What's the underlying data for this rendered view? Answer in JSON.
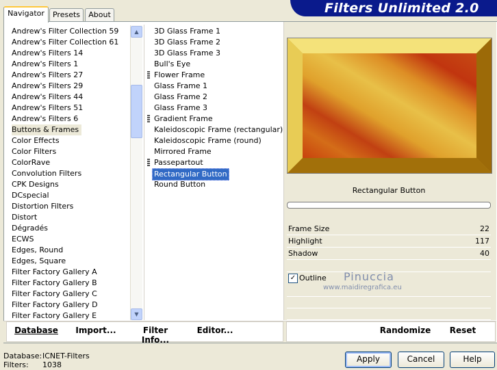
{
  "banner": {
    "title": "Filters Unlimited 2.0"
  },
  "tabs": [
    {
      "label": "Navigator",
      "active": true
    },
    {
      "label": "Presets",
      "active": false
    },
    {
      "label": "About",
      "active": false
    }
  ],
  "categories": {
    "items": [
      "Andrew's Filter Collection 59",
      "Andrew's Filter Collection 61",
      "Andrew's Filters 14",
      "Andrew's Filters 1",
      "Andrew's Filters 27",
      "Andrew's Filters 29",
      "Andrew's Filters 44",
      "Andrew's Filters 51",
      "Andrew's Filters 6",
      "Buttons & Frames",
      "Color Effects",
      "Color Filters",
      "ColorRave",
      "Convolution Filters",
      "CPK Designs",
      "DCspecial",
      "Distortion Filters",
      "Distort",
      "Dégradés",
      "ECWS",
      "Edges, Round",
      "Edges, Square",
      "Filter Factory Gallery A",
      "Filter Factory Gallery B",
      "Filter Factory Gallery C",
      "Filter Factory Gallery D",
      "Filter Factory Gallery E"
    ],
    "selected": "Buttons & Frames"
  },
  "filters": {
    "items": [
      {
        "label": "3D Glass Frame 1",
        "marked": false
      },
      {
        "label": "3D Glass Frame 2",
        "marked": false
      },
      {
        "label": "3D Glass Frame 3",
        "marked": false
      },
      {
        "label": "Bull's Eye",
        "marked": false
      },
      {
        "label": "Flower Frame",
        "marked": true
      },
      {
        "label": "Glass Frame 1",
        "marked": false
      },
      {
        "label": "Glass Frame 2",
        "marked": false
      },
      {
        "label": "Glass Frame 3",
        "marked": false
      },
      {
        "label": "Gradient Frame",
        "marked": true
      },
      {
        "label": "Kaleidoscopic Frame (rectangular)",
        "marked": false
      },
      {
        "label": "Kaleidoscopic Frame (round)",
        "marked": false
      },
      {
        "label": "Mirrored Frame",
        "marked": false
      },
      {
        "label": "Passepartout",
        "marked": true
      },
      {
        "label": "Rectangular Button",
        "marked": false
      },
      {
        "label": "Round Button",
        "marked": false
      }
    ],
    "selected": "Rectangular Button"
  },
  "preview": {
    "filter_name": "Rectangular Button",
    "watermark_name": "Pinuccia",
    "watermark_url": "www.maidiregrafica.eu"
  },
  "params": [
    {
      "label": "Frame Size",
      "value": "22"
    },
    {
      "label": "Highlight",
      "value": "117"
    },
    {
      "label": "Shadow",
      "value": "40"
    }
  ],
  "outline": {
    "label": "Outline",
    "checked": true
  },
  "toolbar": {
    "database": "Database",
    "import": "Import...",
    "filter_info": "Filter Info...",
    "editor": "Editor...",
    "randomize": "Randomize",
    "reset": "Reset"
  },
  "status": {
    "database_label": "Database:",
    "database_value": "ICNET-Filters",
    "filters_label": "Filters:",
    "filters_value": "1038"
  },
  "dialog": {
    "apply": "Apply",
    "cancel": "Cancel",
    "help": "Help"
  },
  "icons": {
    "scroll_up": "▲",
    "scroll_down": "▼",
    "check": "✓"
  }
}
